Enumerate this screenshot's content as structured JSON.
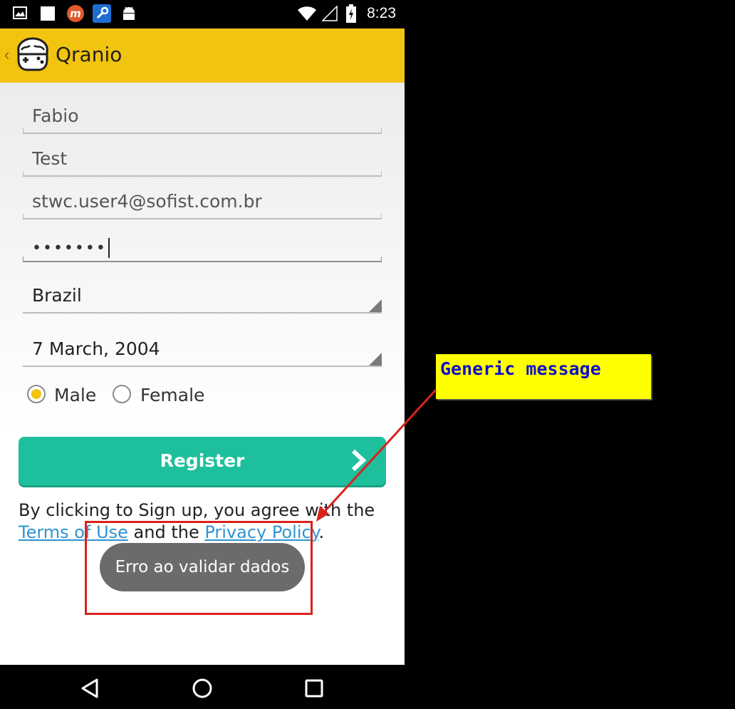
{
  "status_bar": {
    "time": "8:23",
    "icons": [
      "gallery-icon",
      "square-icon",
      "m-app-icon",
      "wrench-icon",
      "android-icon",
      "wifi-icon",
      "signal-icon",
      "battery-charging-icon"
    ]
  },
  "app_bar": {
    "title": "Qranio",
    "back_icon": "chevron-left-icon",
    "logo_icon": "brain-gamepad-logo",
    "color": "#f2c40f"
  },
  "form": {
    "first_name": "Fabio",
    "last_name": "Test",
    "email": "stwc.user4@sofist.com.br",
    "password_mask": "•••••••",
    "country": "Brazil",
    "birth_date": "7 March, 2004",
    "gender_options": [
      "Male",
      "Female"
    ],
    "gender_selected": "Male"
  },
  "register_button": {
    "label": "Register",
    "color": "#1ebf9c"
  },
  "terms": {
    "prefix": "By clicking to Sign up, you agree with the ",
    "terms_link": "Terms of Use",
    "middle": " and the ",
    "privacy_link": "Privacy Policy",
    "suffix": ".",
    "link_color": "#2f93d1"
  },
  "toast": {
    "message": "Erro ao validar dados"
  },
  "annotation": {
    "note_text": "Generic message",
    "note_bg": "#ffff00",
    "note_text_color": "#1010c8",
    "arrow_color": "#d8231c"
  },
  "nav_bar": {
    "icons": [
      "back-triangle-icon",
      "home-circle-icon",
      "recents-square-icon"
    ]
  }
}
